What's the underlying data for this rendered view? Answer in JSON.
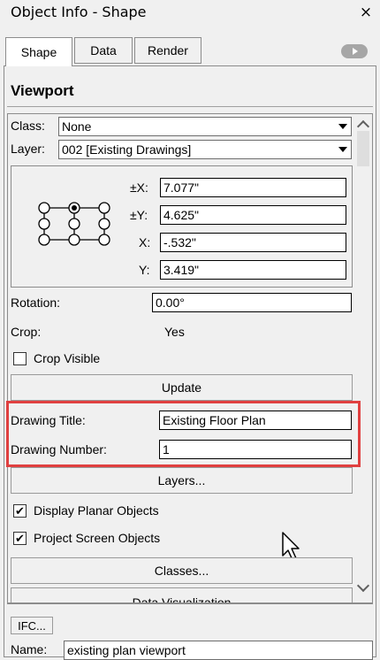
{
  "window": {
    "title": "Object Info - Shape",
    "close_glyph": "×"
  },
  "tabs": [
    {
      "label": "Shape",
      "active": true
    },
    {
      "label": "Data",
      "active": false
    },
    {
      "label": "Render",
      "active": false
    }
  ],
  "tabs_more_icon": "chevron-right-icon",
  "section": {
    "title": "Viewport"
  },
  "class_field": {
    "label": "Class:",
    "value": "None"
  },
  "layer_field": {
    "label": "Layer:",
    "value": "002 [Existing Drawings]"
  },
  "position": {
    "width_label": "±X:",
    "width_value": "7.077\"",
    "height_label": "±Y:",
    "height_value": "4.625\"",
    "x_label": "X:",
    "x_value": "-.532\"",
    "y_label": "Y:",
    "y_value": "3.419\""
  },
  "rotation": {
    "label": "Rotation:",
    "value": "0.00°"
  },
  "crop": {
    "label": "Crop:",
    "value": "Yes"
  },
  "crop_visible": {
    "label": "Crop Visible",
    "checked": false
  },
  "update_button": "Update",
  "drawing_title": {
    "label": "Drawing Title:",
    "value": "Existing Floor Plan"
  },
  "drawing_number": {
    "label": "Drawing Number:",
    "value": "1"
  },
  "layers_button": "Layers...",
  "display_planar": {
    "label": "Display Planar Objects",
    "checked": true
  },
  "project_screen": {
    "label": "Project Screen Objects",
    "checked": true
  },
  "classes_button": "Classes...",
  "data_vis_button": "Data Visualization",
  "ifc_button": "IFC...",
  "name_field": {
    "label": "Name:",
    "value": "existing plan viewport"
  },
  "colors": {
    "highlight": "#e04040",
    "panel": "#f0f0f0"
  }
}
